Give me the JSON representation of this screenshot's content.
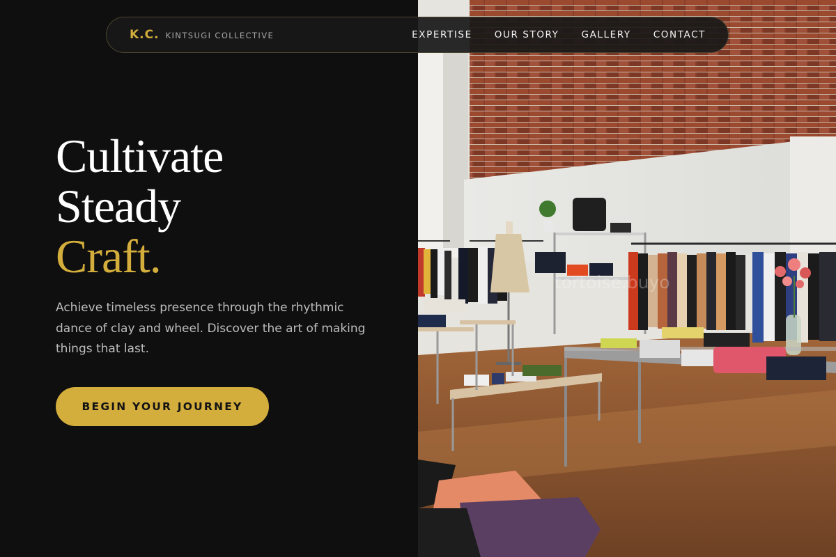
{
  "nav": {
    "brand_mark": "K.C.",
    "brand_name": "KINTSUGI COLLECTIVE",
    "links": [
      "EXPERTISE",
      "OUR STORY",
      "GALLERY",
      "CONTACT"
    ]
  },
  "hero": {
    "title_line1": "Cultivate",
    "title_line2": "Steady",
    "title_line3": "Craft.",
    "description": "Achieve timeless presence through the rhythmic dance of clay and wheel. Discover the art of making things that last.",
    "cta_label": "BEGIN YOUR JOURNEY"
  },
  "image": {
    "watermark": "tortoise.buyo"
  },
  "colors": {
    "accent": "#d4ae3c",
    "background": "#0f0f0f",
    "text": "#ffffff",
    "muted": "#bdbdbd"
  }
}
